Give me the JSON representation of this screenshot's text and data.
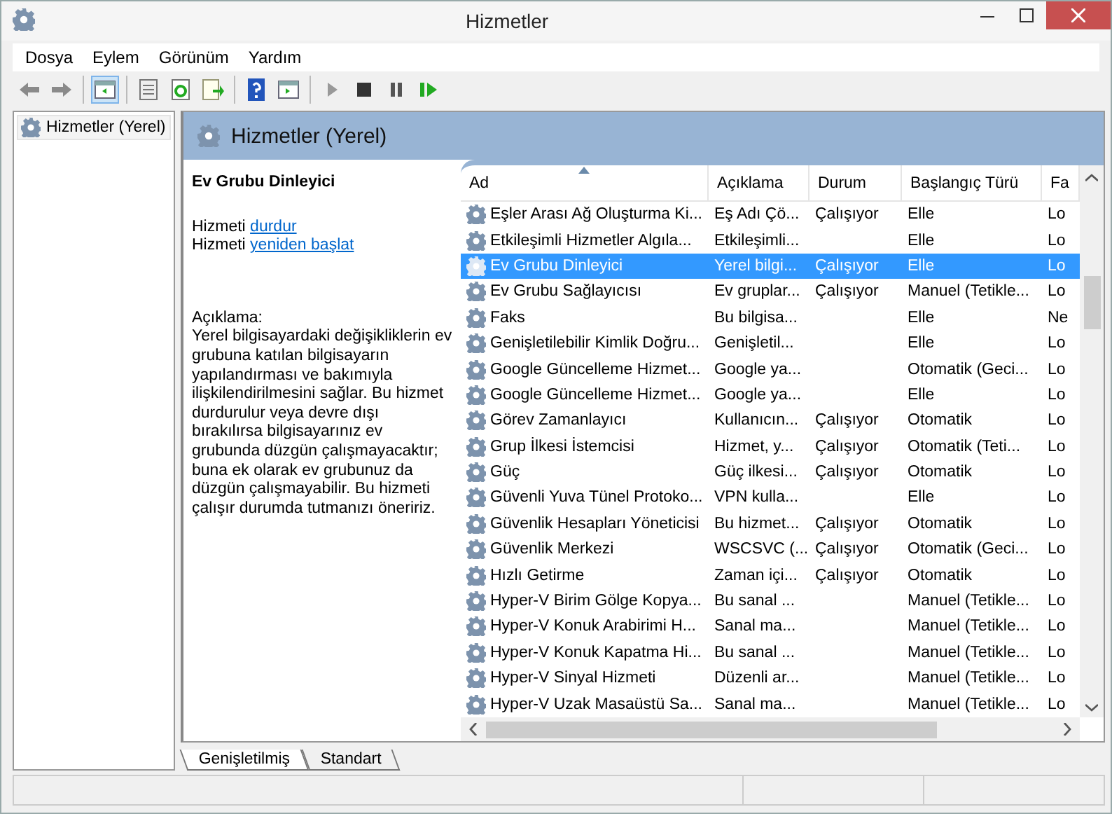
{
  "window": {
    "title": "Hizmetler"
  },
  "menu": [
    "Dosya",
    "Eylem",
    "Görünüm",
    "Yardım"
  ],
  "toolbar": [
    {
      "kind": "back",
      "selected": false
    },
    {
      "kind": "forward",
      "selected": false
    },
    {
      "kind": "sep"
    },
    {
      "kind": "tree",
      "selected": true
    },
    {
      "kind": "sep"
    },
    {
      "kind": "properties",
      "selected": false
    },
    {
      "kind": "refresh",
      "selected": false
    },
    {
      "kind": "export",
      "selected": false
    },
    {
      "kind": "sep"
    },
    {
      "kind": "help",
      "selected": false
    },
    {
      "kind": "view",
      "selected": false
    },
    {
      "kind": "sep"
    },
    {
      "kind": "play",
      "selected": false
    },
    {
      "kind": "stop",
      "selected": false
    },
    {
      "kind": "pause",
      "selected": false
    },
    {
      "kind": "resume",
      "selected": false
    }
  ],
  "tree": {
    "items": [
      {
        "label": "Hizmetler (Yerel)",
        "selected": false
      }
    ]
  },
  "panel": {
    "title": "Hizmetler (Yerel)"
  },
  "details": {
    "service": "Ev Grubu Dinleyici",
    "actions": [
      {
        "prefix": "Hizmeti",
        "link": "durdur"
      },
      {
        "prefix": "Hizmeti",
        "link": "yeniden başlat"
      }
    ],
    "description_label": "Açıklama:",
    "description": "Yerel bilgisayardaki değişikliklerin ev grubuna katılan bilgisayarın yapılandırması ve bakımıyla ilişkilendirilmesini sağlar. Bu hizmet durdurulur veya devre dışı bırakılırsa bilgisayarınız ev grubunda düzgün çalışmayacaktır; buna ek olarak ev grubunuz da düzgün çalışmayabilir. Bu hizmeti çalışır durumda tutmanızı öneririz."
  },
  "table": {
    "columns": [
      {
        "label": "Ad",
        "sorted": true
      },
      {
        "label": "Açıklama",
        "sorted": false
      },
      {
        "label": "Durum",
        "sorted": false
      },
      {
        "label": "Başlangıç Türü",
        "sorted": false
      },
      {
        "label": "Fa",
        "sorted": false
      }
    ],
    "rows": [
      {
        "cells": [
          "Eşler Arası Ağ Oluşturma Ki...",
          "Eş Adı Çö...",
          "Çalışıyor",
          "Elle",
          "Lo"
        ],
        "selected": false
      },
      {
        "cells": [
          "Etkileşimli Hizmetler Algıla...",
          "Etkileşimli...",
          "",
          "Elle",
          "Lo"
        ],
        "selected": false
      },
      {
        "cells": [
          "Ev Grubu Dinleyici",
          "Yerel bilgi...",
          "Çalışıyor",
          "Elle",
          "Lo"
        ],
        "selected": true
      },
      {
        "cells": [
          "Ev Grubu Sağlayıcısı",
          "Ev gruplar...",
          "Çalışıyor",
          "Manuel (Tetikle...",
          "Lo"
        ],
        "selected": false
      },
      {
        "cells": [
          "Faks",
          "Bu bilgisa...",
          "",
          "Elle",
          "Ne"
        ],
        "selected": false
      },
      {
        "cells": [
          "Genişletilebilir Kimlik Doğru...",
          "Genişletil...",
          "",
          "Elle",
          "Lo"
        ],
        "selected": false
      },
      {
        "cells": [
          "Google Güncelleme Hizmet...",
          "Google ya...",
          "",
          "Otomatik (Geci...",
          "Lo"
        ],
        "selected": false
      },
      {
        "cells": [
          "Google Güncelleme Hizmet...",
          "Google ya...",
          "",
          "Elle",
          "Lo"
        ],
        "selected": false
      },
      {
        "cells": [
          "Görev Zamanlayıcı",
          "Kullanıcın...",
          "Çalışıyor",
          "Otomatik",
          "Lo"
        ],
        "selected": false
      },
      {
        "cells": [
          "Grup İlkesi İstemcisi",
          "Hizmet, y...",
          "Çalışıyor",
          "Otomatik (Teti...",
          "Lo"
        ],
        "selected": false
      },
      {
        "cells": [
          "Güç",
          "Güç ilkesi...",
          "Çalışıyor",
          "Otomatik",
          "Lo"
        ],
        "selected": false
      },
      {
        "cells": [
          "Güvenli Yuva Tünel Protoko...",
          "VPN kulla...",
          "",
          "Elle",
          "Lo"
        ],
        "selected": false
      },
      {
        "cells": [
          "Güvenlik Hesapları Yöneticisi",
          "Bu hizmet...",
          "Çalışıyor",
          "Otomatik",
          "Lo"
        ],
        "selected": false
      },
      {
        "cells": [
          "Güvenlik Merkezi",
          "WSCSVC (...",
          "Çalışıyor",
          "Otomatik (Geci...",
          "Lo"
        ],
        "selected": false
      },
      {
        "cells": [
          "Hızlı Getirme",
          "Zaman içi...",
          "Çalışıyor",
          "Otomatik",
          "Lo"
        ],
        "selected": false
      },
      {
        "cells": [
          "Hyper-V Birim Gölge Kopya...",
          "Bu sanal ...",
          "",
          "Manuel (Tetikle...",
          "Lo"
        ],
        "selected": false
      },
      {
        "cells": [
          "Hyper-V Konuk Arabirimi H...",
          "Sanal ma...",
          "",
          "Manuel (Tetikle...",
          "Lo"
        ],
        "selected": false
      },
      {
        "cells": [
          "Hyper-V Konuk Kapatma Hi...",
          "Bu sanal ...",
          "",
          "Manuel (Tetikle...",
          "Lo"
        ],
        "selected": false
      },
      {
        "cells": [
          "Hyper-V Sinyal Hizmeti",
          "Düzenli ar...",
          "",
          "Manuel (Tetikle...",
          "Lo"
        ],
        "selected": false
      },
      {
        "cells": [
          "Hyper-V Uzak Masaüstü Sa...",
          "Sanal ma...",
          "",
          "Manuel (Tetikle...",
          "Lo"
        ],
        "selected": false
      }
    ]
  },
  "view_tabs": [
    {
      "label": "Genişletilmiş",
      "selected": true
    },
    {
      "label": "Standart",
      "selected": false
    }
  ]
}
